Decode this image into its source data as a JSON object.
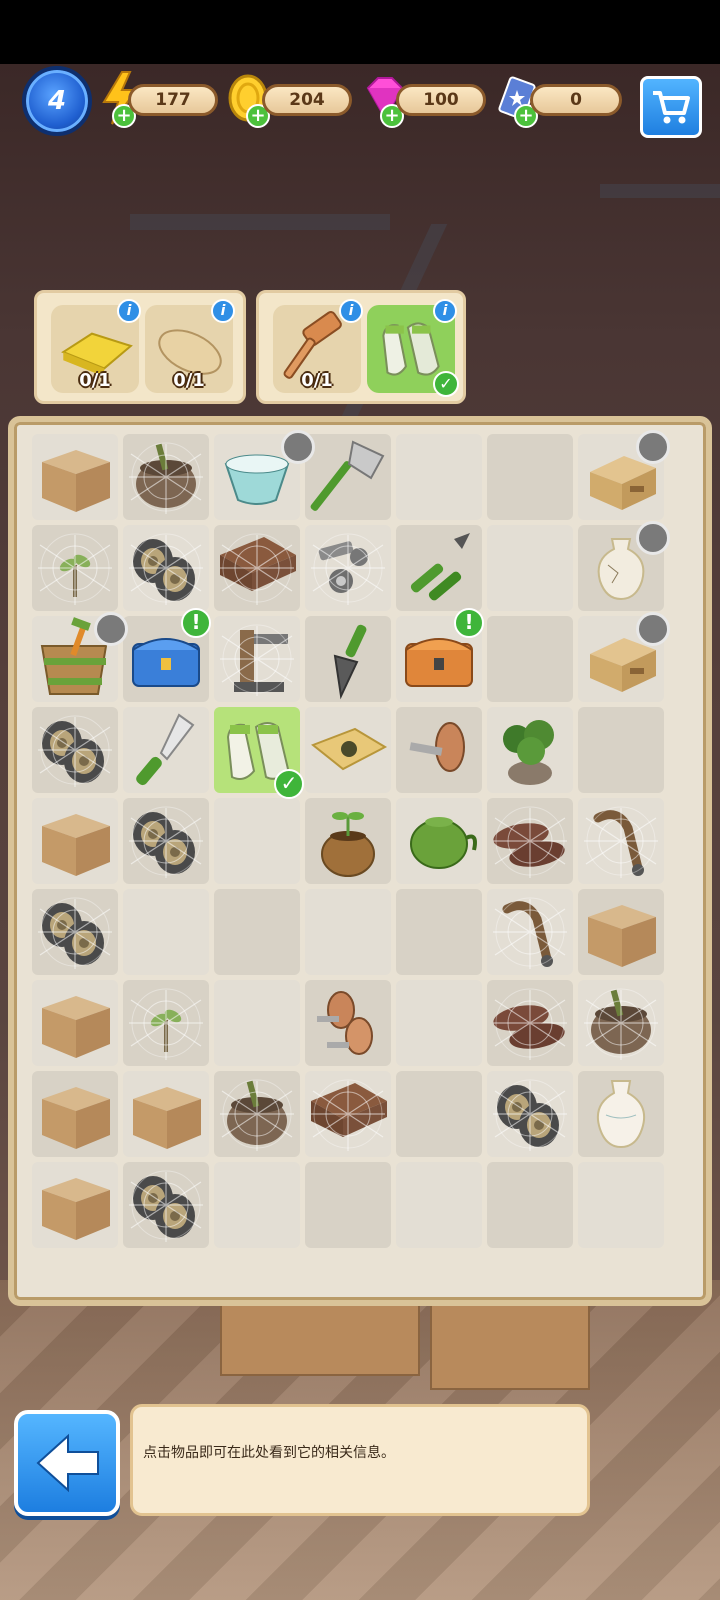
{
  "hud": {
    "level": "4",
    "energy": "177",
    "coins": "204",
    "gems": "100",
    "cards": "0",
    "plus_symbol": "+",
    "icons": [
      "lightning-icon",
      "coin-icon",
      "gem-icon",
      "card-icon",
      "cart-icon"
    ]
  },
  "orders": [
    {
      "items": [
        {
          "name": "sponge",
          "count": "0/1",
          "done": false
        },
        {
          "name": "soap-bar",
          "count": "0/1",
          "done": false
        }
      ]
    },
    {
      "items": [
        {
          "name": "mallet",
          "count": "0/1",
          "done": false
        },
        {
          "name": "gardening-gloves",
          "count": "",
          "done": true
        }
      ]
    }
  ],
  "board": {
    "rows": [
      [
        "cardboard-box",
        "cobwebbed-pot",
        "ceramic-bowl",
        "axe",
        "empty",
        "empty",
        "wooden-drawers"
      ],
      [
        "cobwebbed-sapling",
        "cobwebbed-tires",
        "cobwebbed-drawer",
        "cobwebbed-bolts",
        "pliers",
        "empty",
        "cracked-vase"
      ],
      [
        "tool-bucket",
        "blue-chest",
        "cobwebbed-vise",
        "trowel",
        "orange-chest",
        "empty",
        "wooden-drawers"
      ],
      [
        "cobwebbed-tires",
        "knife",
        "gardening-gloves",
        "seed-packet",
        "screw-plug",
        "potted-plant",
        "empty"
      ],
      [
        "cardboard-box",
        "cobwebbed-tires",
        "empty",
        "seedling-pot",
        "green-teapot",
        "cobwebbed-shoes",
        "cobwebbed-handle"
      ],
      [
        "cobwebbed-tires",
        "empty",
        "empty",
        "empty",
        "empty",
        "cobwebbed-handle",
        "cardboard-box"
      ],
      [
        "cardboard-box",
        "cobwebbed-sapling",
        "empty",
        "screw-plugs",
        "empty",
        "cobwebbed-shoes",
        "cobwebbed-pot"
      ],
      [
        "cardboard-box",
        "cardboard-box",
        "cobwebbed-pot",
        "cobwebbed-drawer",
        "empty",
        "cobwebbed-tires",
        "white-vase"
      ],
      [
        "cardboard-box",
        "cobwebbed-tires",
        "empty",
        "empty",
        "empty",
        "empty",
        "empty"
      ]
    ],
    "timer_badges": [
      "axe",
      "wooden-drawers",
      "cracked-vase",
      "tool-bucket",
      "wooden-drawers-2"
    ],
    "ready_badges": [
      "blue-chest",
      "orange-chest"
    ],
    "ready_symbol": "!",
    "check_symbol": "✓"
  },
  "info_panel": {
    "text": "点击物品即可在此处看到它的相关信息。"
  },
  "colors": {
    "accent_blue": "#1f7fe0",
    "accent_green": "#3fb53a",
    "panel_cream": "#f3e6c9",
    "board_bg": "#e9e2d4"
  }
}
